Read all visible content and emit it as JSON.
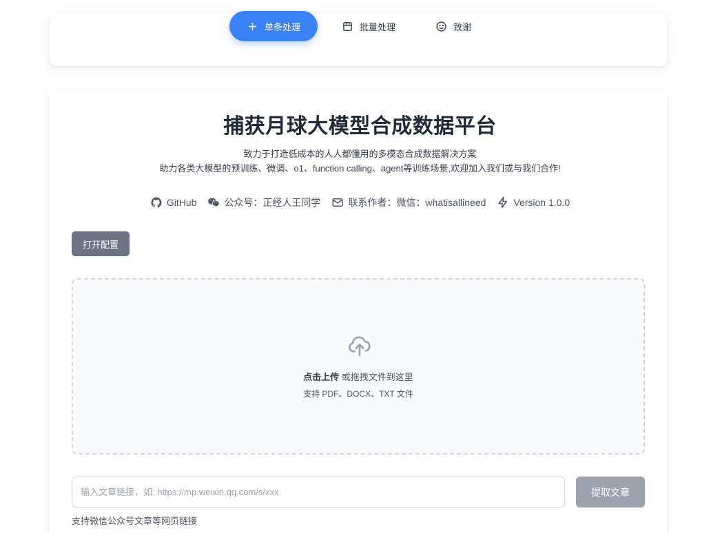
{
  "nav": {
    "items": [
      {
        "label": "单条处理",
        "icon": "plus-icon",
        "active": true
      },
      {
        "label": "批量处理",
        "icon": "calendar-icon",
        "active": false
      },
      {
        "label": "致谢",
        "icon": "smile-icon",
        "active": false
      }
    ]
  },
  "header": {
    "title": "捕获月球大模型合成数据平台",
    "subtitle_line1": "致力于打造低成本的人人都懂用的多模态合成数据解决方案",
    "subtitle_line2": "助力各类大模型的预训练、微调、o1、function calling、agent等训练场景,欢迎加入我们或与我们合作!"
  },
  "links": {
    "github": "GitHub",
    "wechat": "公众号：正经人王同学",
    "contact": "联系作者：微信：whatisallineed",
    "version": "Version 1.0.0"
  },
  "config_button": "打开配置",
  "upload": {
    "strong": "点击上传",
    "text": " 或拖拽文件到这里",
    "hint": "支持 PDF、DOCX、TXT 文件"
  },
  "url": {
    "value": "",
    "placeholder": "输入文章链接，如: https://mp.weixin.qq.com/s/xxx",
    "button": "提取文章",
    "hint": "支持微信公众号文章等网页链接"
  },
  "colors": {
    "accent": "#3b82f6",
    "config_button": "#6b7280",
    "extract_button": "#9ca3af"
  }
}
